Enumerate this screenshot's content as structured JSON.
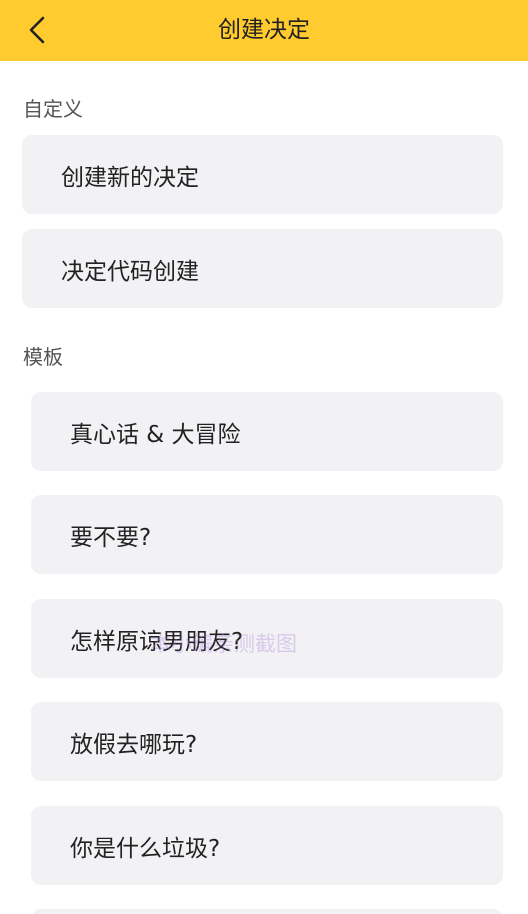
{
  "header": {
    "title": "创建决定",
    "back_icon": "chevron-left-icon"
  },
  "sections": {
    "custom_label": "自定义",
    "template_label": "模板"
  },
  "custom_items": [
    {
      "label": "创建新的决定"
    },
    {
      "label": "决定代码创建"
    }
  ],
  "template_items": [
    {
      "label": "真心话 & 大冒险"
    },
    {
      "label": "要不要?"
    },
    {
      "label": "怎样原谅男朋友?"
    },
    {
      "label": "放假去哪玩?"
    },
    {
      "label": "你是什么垃圾?"
    }
  ],
  "watermark_text": "本小编亲测截图",
  "colors": {
    "header_bg": "#FFCB2F",
    "card_bg": "#F2F2F5",
    "text": "#222222",
    "section_text": "#555555"
  }
}
